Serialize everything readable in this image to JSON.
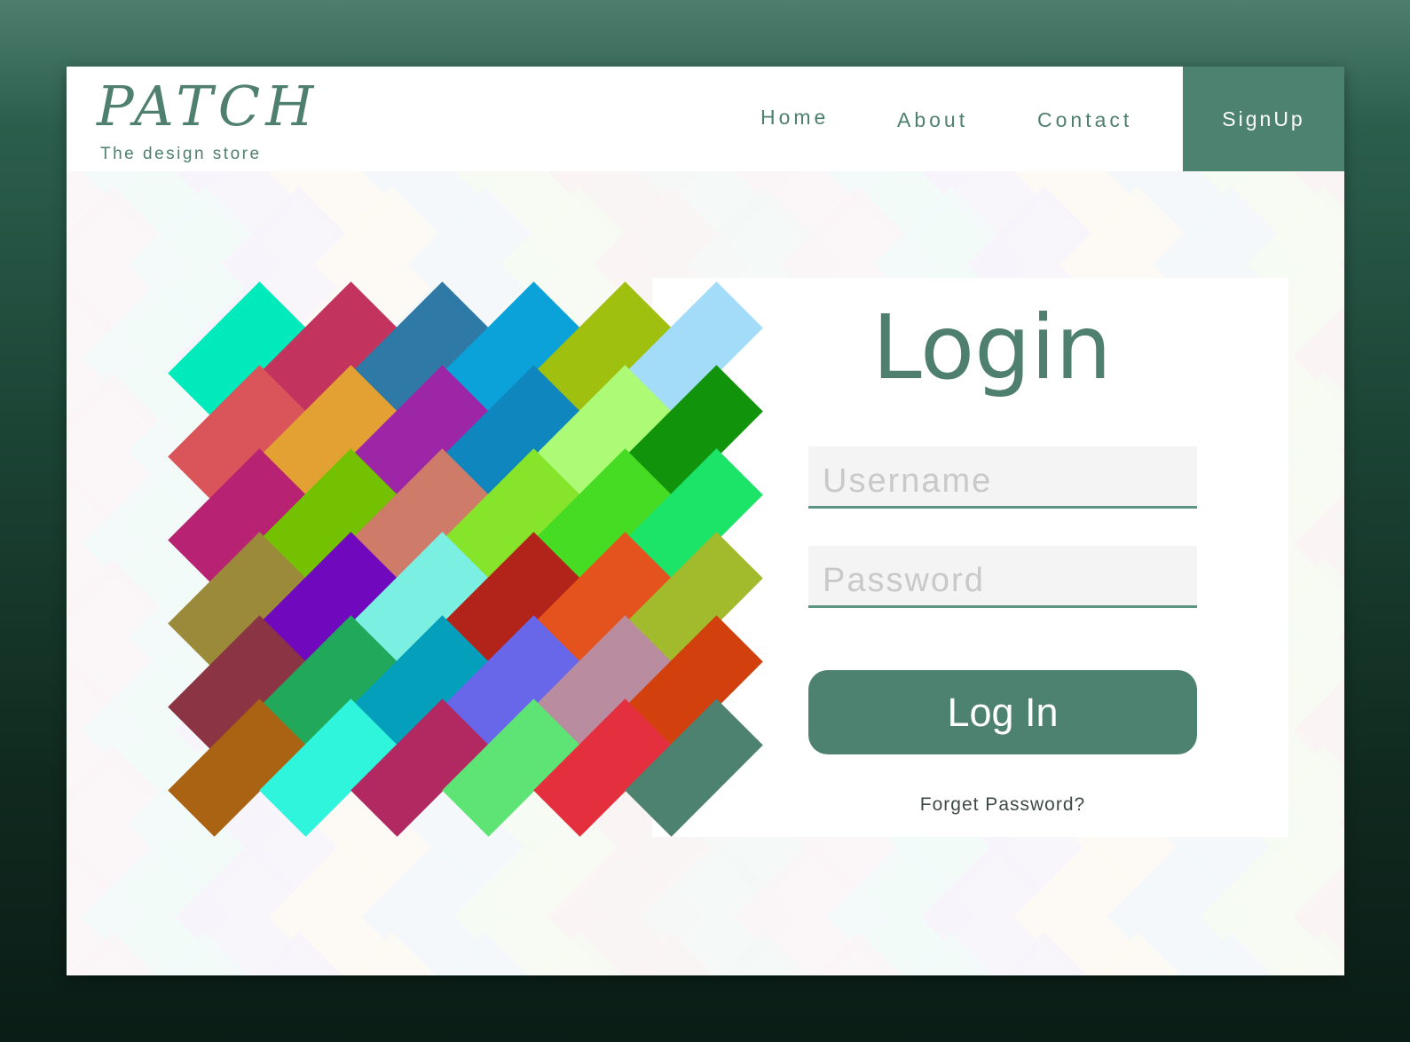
{
  "header": {
    "logo": "PATCH",
    "tagline": "The design store",
    "nav": {
      "home": "Home",
      "about": "About",
      "contact": "Contact",
      "signup": "SignUp"
    }
  },
  "login": {
    "title": "Login",
    "username_placeholder": "Username",
    "password_placeholder": "Password",
    "button": "Log In",
    "forgot": "Forget Password?"
  },
  "colors": {
    "accent": "#4e8270",
    "accent_text": "#4e7f6f",
    "weave_tiles": [
      [
        "#00eabb",
        "#c2335d",
        "#2f79a7",
        "#0ba1d9",
        "#a0c00f",
        "#a3dcf8"
      ],
      [
        "#d9555a",
        "#e4a133",
        "#9d26a6",
        "#0f86be",
        "#acfa75",
        "#11940c"
      ],
      [
        "#b82273",
        "#73c100",
        "#cf7b69",
        "#86e52b",
        "#46dc24",
        "#1be468"
      ],
      [
        "#9c8a3b",
        "#7009bd",
        "#7befe2",
        "#b2241a",
        "#e4531d",
        "#a2bb2d"
      ],
      [
        "#8b3444",
        "#22a85a",
        "#039fbb",
        "#6867ea",
        "#b98c9f",
        "#d2410d"
      ],
      [
        "#a96312",
        "#30f5dd",
        "#b22962",
        "#5ee475",
        "#e42f3f",
        "#4e8270"
      ]
    ]
  }
}
